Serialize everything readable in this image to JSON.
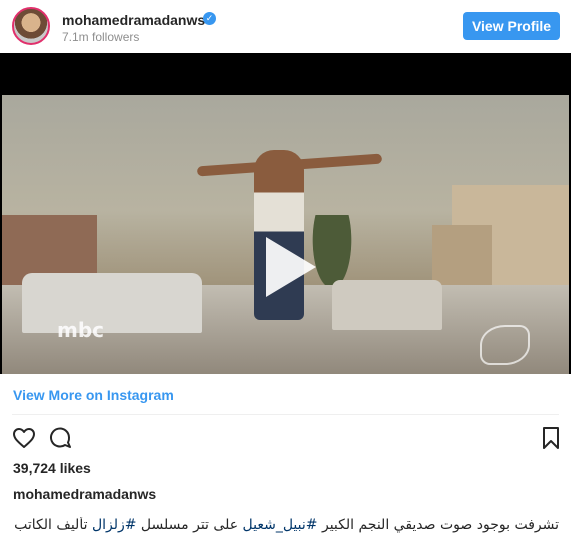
{
  "header": {
    "username": "mohamedramadanws",
    "followers": "7.1m followers",
    "view_profile_label": "View Profile"
  },
  "media": {
    "logo_text": "mbc"
  },
  "footer": {
    "view_more_label": "View More on Instagram",
    "likes": "39,724 likes",
    "caption_username": "mohamedramadanws",
    "caption_part1": "تشرفت بوجود صوت صديقي النجم الكبير ",
    "hashtag1": "#نبيل_شعيل",
    "caption_part2": " على تتر مسلسل ",
    "hashtag2": "#زلزال",
    "caption_part3": " تأليف الكاتب"
  },
  "colors": {
    "accent": "#3897f0",
    "hashtag": "#003569"
  },
  "icons": [
    "verified-badge-icon",
    "play-icon",
    "heart-icon",
    "comment-icon",
    "bookmark-icon"
  ]
}
